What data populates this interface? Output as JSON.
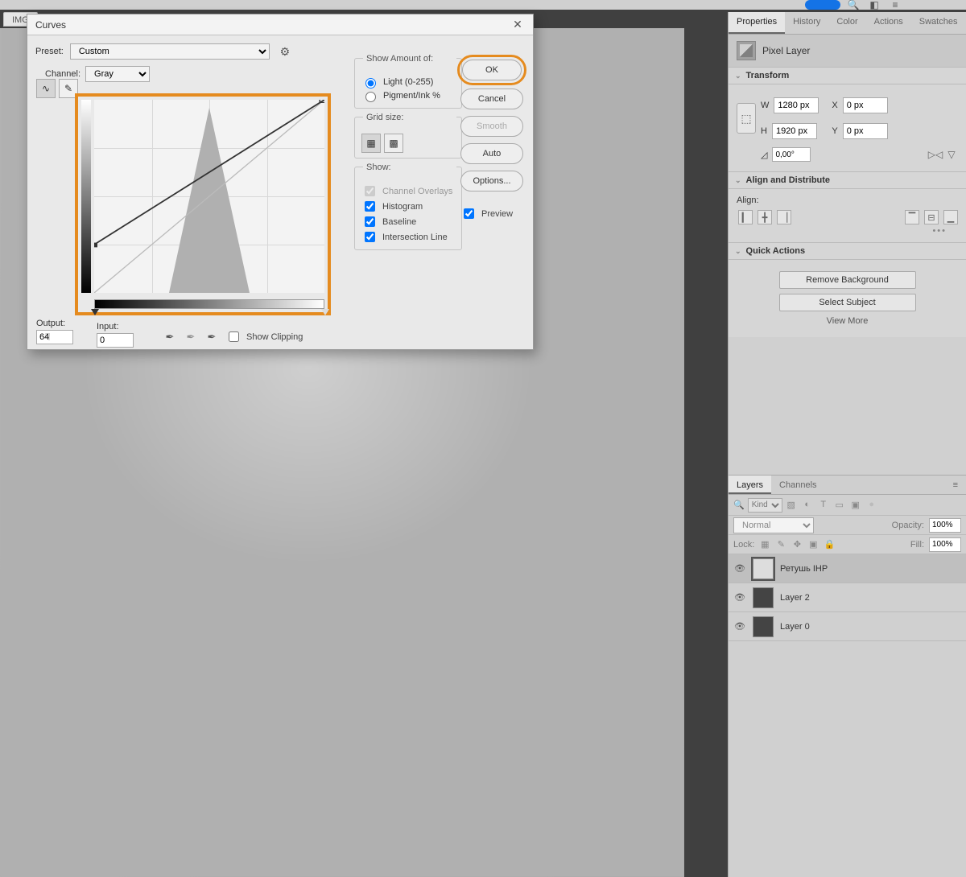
{
  "document": {
    "tab": "IMG"
  },
  "dialog": {
    "title": "Curves",
    "preset_label": "Preset:",
    "preset_value": "Custom",
    "channel_label": "Channel:",
    "channel_value": "Gray",
    "output_label": "Output:",
    "output_value": "64",
    "input_label": "Input:",
    "input_value": "0",
    "show_clipping_label": "Show Clipping",
    "show_amount": {
      "legend": "Show Amount of:",
      "light": "Light (0-255)",
      "pigment": "Pigment/Ink %"
    },
    "grid": {
      "legend": "Grid size:"
    },
    "show": {
      "legend": "Show:",
      "channel_overlays": "Channel Overlays",
      "histogram": "Histogram",
      "baseline": "Baseline",
      "intersection": "Intersection Line"
    },
    "buttons": {
      "ok": "OK",
      "cancel": "Cancel",
      "smooth": "Smooth",
      "auto": "Auto",
      "options": "Options..."
    },
    "preview_label": "Preview"
  },
  "properties": {
    "tabs": [
      "Properties",
      "History",
      "Color",
      "Actions",
      "Swatches"
    ],
    "kind": "Pixel Layer",
    "transform": {
      "title": "Transform",
      "w_label": "W",
      "w": "1280 px",
      "h_label": "H",
      "h": "1920 px",
      "x_label": "X",
      "x": "0 px",
      "y_label": "Y",
      "y": "0 px",
      "angle": "0,00°"
    },
    "align": {
      "title": "Align and Distribute",
      "label": "Align:"
    },
    "quick": {
      "title": "Quick Actions",
      "remove_bg": "Remove Background",
      "select_subject": "Select Subject",
      "view_more": "View More"
    }
  },
  "layers": {
    "tabs": [
      "Layers",
      "Channels"
    ],
    "kind_label": "Kind",
    "blend": "Normal",
    "opacity_label": "Opacity:",
    "opacity": "100%",
    "lock_label": "Lock:",
    "fill_label": "Fill:",
    "fill": "100%",
    "items": [
      {
        "name": "Ретушь IHP"
      },
      {
        "name": "Layer 2"
      },
      {
        "name": "Layer 0"
      }
    ]
  }
}
